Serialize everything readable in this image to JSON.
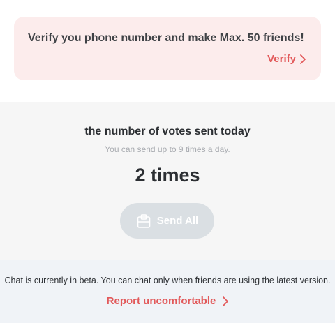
{
  "verify_banner": {
    "message": "Verify you phone number and make Max. 50 friends!",
    "link_label": "Verify"
  },
  "votes": {
    "title": "the number of votes sent today",
    "subtitle": "You can send up to 9 times a day.",
    "count_text": "2 times",
    "send_all_label": "Send All"
  },
  "beta": {
    "notice": "Chat is currently in beta. You can chat only when friends are using the latest version.",
    "report_label": "Report uncomfortable"
  },
  "colors": {
    "accent": "#e2595a",
    "banner_bg": "#fcecec",
    "disabled_button": "#dadfe3"
  },
  "icons": {
    "verify_chevron": "chevron-right-icon",
    "send_all": "clipboard-icon",
    "report_chevron": "chevron-right-icon"
  }
}
